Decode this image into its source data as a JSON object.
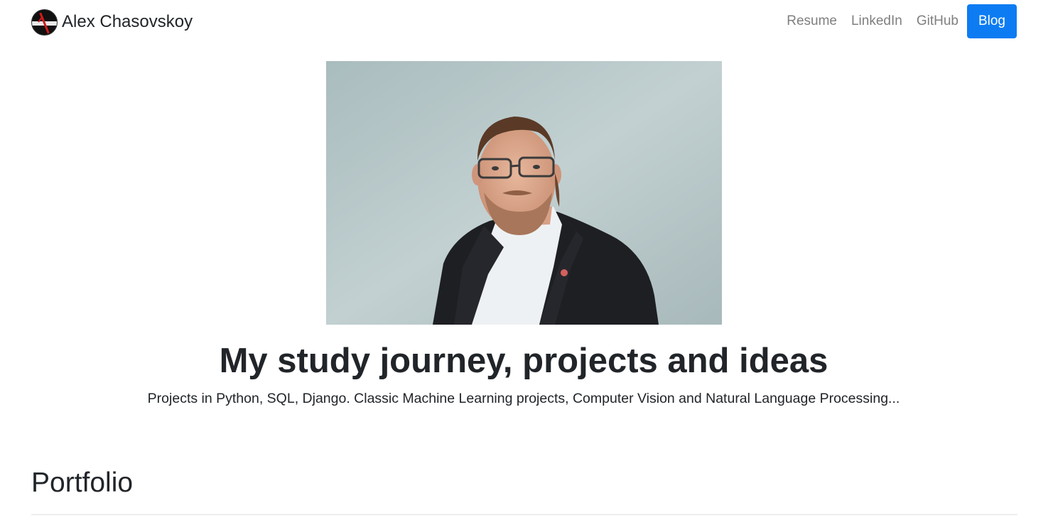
{
  "brand": {
    "name": "Alex Chasovskoy",
    "logo": "site-logo"
  },
  "nav": {
    "links": [
      {
        "label": "Resume",
        "active": false
      },
      {
        "label": "LinkedIn",
        "active": false
      },
      {
        "label": "GitHub",
        "active": false
      },
      {
        "label": "Blog",
        "active": true
      }
    ],
    "active_color": "#0d7cf2"
  },
  "hero": {
    "photo": "portrait-photo",
    "title": "My study journey, projects and ideas",
    "subtitle": "Projects in Python, SQL, Django. Classic Machine Learning projects, Computer Vision and Natural Language Processing..."
  },
  "portfolio": {
    "title": "Portfolio"
  }
}
